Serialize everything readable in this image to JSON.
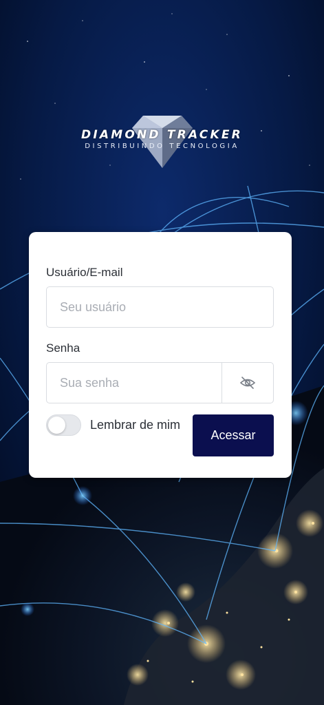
{
  "brand": {
    "title": "DIAMOND TRACKER",
    "subtitle": "DISTRIBUINDO TECNOLOGIA"
  },
  "login": {
    "user_label": "Usuário/E-mail",
    "user_placeholder": "Seu usuário",
    "password_label": "Senha",
    "password_placeholder": "Sua senha",
    "remember_label": "Lembrar de mim",
    "remember_checked": false,
    "submit_label": "Acessar"
  },
  "colors": {
    "submit_bg": "#0b0f4f",
    "background": "#041330"
  },
  "icons": {
    "password_toggle": "eye-slash-icon",
    "logo": "diamond-icon"
  }
}
